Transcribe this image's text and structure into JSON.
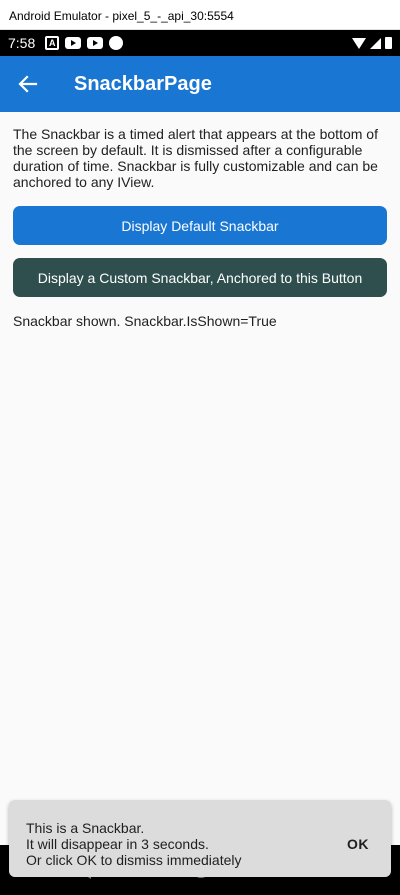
{
  "window": {
    "title": "Android Emulator - pixel_5_-_api_30:5554"
  },
  "status_bar": {
    "time": "7:58",
    "icons": [
      "a-icon",
      "youtube-icon",
      "youtube-icon",
      "circle-icon",
      "wifi-icon",
      "signal-icon",
      "battery-icon"
    ]
  },
  "app_bar": {
    "title": "SnackbarPage",
    "back_icon": "arrow-left-icon",
    "color": "#1976d2"
  },
  "content": {
    "description": "The Snackbar is a timed alert that appears at the bottom of the screen by default. It is dismissed after a configurable duration of time. Snackbar is fully customizable and can be anchored to any IView.",
    "default_button_label": "Display Default Snackbar",
    "custom_button_label": "Display a Custom Snackbar, Anchored to this Button",
    "status_text": "Snackbar shown. Snackbar.IsShown=True"
  },
  "snackbar": {
    "message": "This is a Snackbar.\nIt will disappear in 3 seconds.\nOr click OK to dismiss immediately",
    "action_label": "OK"
  },
  "colors": {
    "primary": "#1976d2",
    "custom_button": "#2f4f4f",
    "snackbar_bg": "#dcdcdc"
  }
}
